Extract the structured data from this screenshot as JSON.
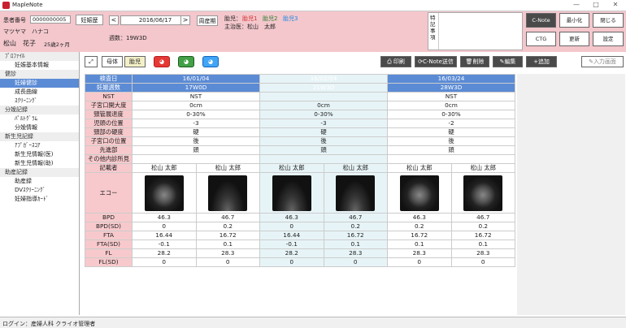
{
  "window": {
    "title": "MapleNote",
    "min": "—",
    "max": "□",
    "close": "✕"
  },
  "patient": {
    "number_label": "患者番号",
    "number": "0000000005",
    "kana": "マツヤマ　ハナコ",
    "name": "松山　花子",
    "age": "25歳2ヶ月",
    "status": "妊娠歴"
  },
  "date": {
    "value": "2016/06/17",
    "prev": "<",
    "next": ">",
    "period_label": "周産期",
    "weeks": "週数：19W3D"
  },
  "fetus": {
    "label": "胎児：",
    "f1": "胎児1",
    "f2": "胎児2",
    "f3": "胎児3",
    "doctor": "主治医：松山　太郎"
  },
  "memo": {
    "label": "特記事項"
  },
  "buttons": {
    "cnote": "C-Note",
    "minimize": "最小化",
    "close": "閉じる",
    "ctg": "CTG",
    "update": "更新",
    "settings": "設定"
  },
  "nav": {
    "groups": [
      {
        "label": "ﾌﾟﾛﾌｧｲﾙ",
        "items": [
          "妊娠基本情報"
        ]
      },
      {
        "label": "健診",
        "items": [
          "妊婦健診",
          "成長曲線",
          "ｽｸﾘｰﾆﾝｸﾞ"
        ]
      },
      {
        "label": "分娩記録",
        "items": [
          "ﾊﾟﾙﾄｸﾞﾗﾑ",
          "分娩情報"
        ]
      },
      {
        "label": "新生児記録",
        "items": [
          "ｱﾌﾟｶﾞｰｽｺｱ",
          "新生児情報(医)",
          "新生児情報(助)"
        ]
      },
      {
        "label": "助産記録",
        "items": [
          "助産録",
          "DVｽｸﾘｰﾆﾝｸﾞ",
          "妊婦指導ｶｰﾄﾞ"
        ]
      }
    ],
    "selected": "妊婦健診"
  },
  "toolbar": {
    "mother": "母体",
    "fetus": "胎児",
    "print": "印刷",
    "cnote_send": "C-Note送信",
    "delete": "削除",
    "edit": "編集",
    "add": "追加",
    "input_screen": "入力画面"
  },
  "exam": {
    "row_labels": [
      "検査日",
      "妊娠週数",
      "NST",
      "子宮口開大度",
      "頸管展退度",
      "児頭の位置",
      "頸部の硬度",
      "子宮口の位置",
      "先進部",
      "その他内診所見"
    ],
    "cols": [
      {
        "date": "16/01/04",
        "weeks": "17W0D",
        "nst": "NST",
        "cervix": "0cm",
        "effacement": "0-30%",
        "station": "-3",
        "consistency": "硬",
        "position": "後",
        "presenting": "頭"
      },
      {
        "date": "16/02/04",
        "weeks": "21W3D",
        "nst": "",
        "cervix": "0cm",
        "effacement": "0-30%",
        "station": "-3",
        "consistency": "硬",
        "position": "後",
        "presenting": "頭"
      },
      {
        "date": "16/03/24",
        "weeks": "28W3D",
        "nst": "NST",
        "cervix": "0cm",
        "effacement": "0-30%",
        "station": "-2",
        "consistency": "硬",
        "position": "後",
        "presenting": "頭"
      }
    ],
    "recorder_label": "記載者",
    "recorders": [
      "松山 太郎",
      "松山 太郎",
      "松山 太郎",
      "松山 太郎",
      "松山 太郎",
      "松山 太郎"
    ],
    "echo_label": "エコー",
    "measure_labels": [
      "BPD",
      "BPD(SD)",
      "FTA",
      "FTA(SD)",
      "FL",
      "FL(SD)"
    ],
    "measures": [
      [
        "46.3",
        "46.7",
        "46.3",
        "46.7",
        "46.3",
        "46.7"
      ],
      [
        "0",
        "0.2",
        "0",
        "0.2",
        "0.2",
        "0.2"
      ],
      [
        "16.44",
        "16.72",
        "16.44",
        "16.72",
        "16.72",
        "16.72"
      ],
      [
        "-0.1",
        "0.1",
        "-0.1",
        "0.1",
        "0.1",
        "0.1"
      ],
      [
        "28.2",
        "28.3",
        "28.2",
        "28.3",
        "28.3",
        "28.3"
      ],
      [
        "0",
        "0",
        "0",
        "0",
        "0",
        "0"
      ]
    ]
  },
  "footer": {
    "login": "ログイン：産婦人科 クライオ管理者"
  }
}
